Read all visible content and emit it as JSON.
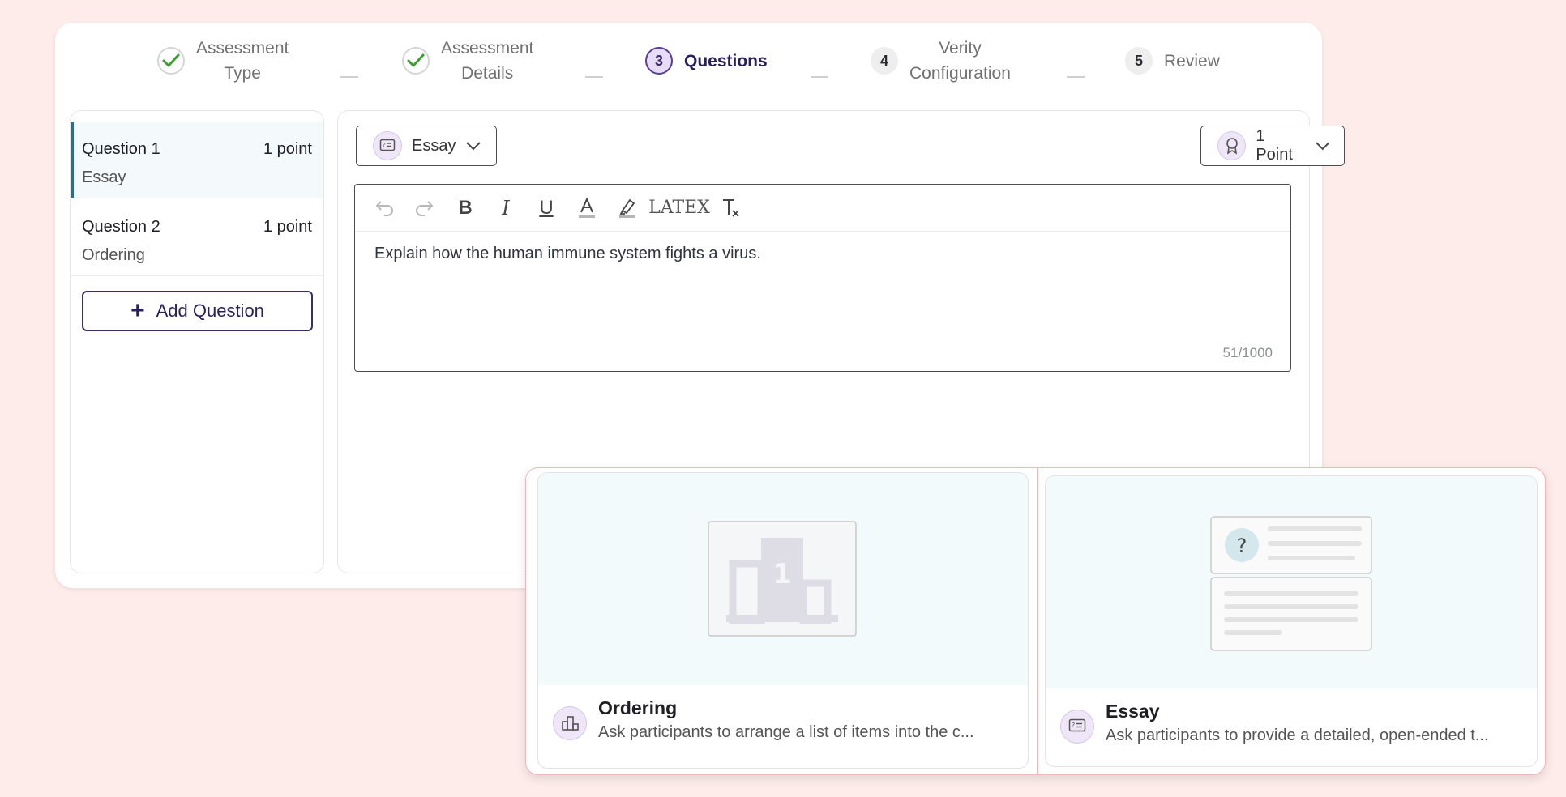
{
  "stepper": {
    "steps": [
      {
        "number": "",
        "label_line1": "Assessment",
        "label_line2": "Type",
        "status": "done"
      },
      {
        "number": "",
        "label_line1": "Assessment",
        "label_line2": "Details",
        "status": "done"
      },
      {
        "number": "3",
        "label_line1": "Questions",
        "label_line2": "",
        "status": "active"
      },
      {
        "number": "4",
        "label_line1": "Verity",
        "label_line2": "Configuration",
        "status": "todo"
      },
      {
        "number": "5",
        "label_line1": "Review",
        "label_line2": "",
        "status": "todo"
      }
    ]
  },
  "questions": [
    {
      "title": "Question 1",
      "points": "1 point",
      "type": "Essay"
    },
    {
      "title": "Question 2",
      "points": "1 point",
      "type": "Ordering"
    }
  ],
  "add_question_label": "Add Question",
  "editor": {
    "type_select": "Essay",
    "points_select": "1 Point",
    "toolbar": [
      "undo",
      "redo",
      "bold",
      "italic",
      "underline",
      "text-color",
      "highlight",
      "latex",
      "clear-format"
    ],
    "latex_label": "LATEX",
    "content": "Explain how the human immune system fights a virus.",
    "char_count": "51/1000"
  },
  "type_cards": [
    {
      "title": "Ordering",
      "description": "Ask participants to arrange a list of items into the c..."
    },
    {
      "title": "Essay",
      "description": "Ask participants to provide a detailed, open-ended t..."
    }
  ],
  "colors": {
    "accent": "#2a1f5e",
    "selected_bar": "#2f6f86",
    "check": "#3aa02f",
    "background": "#fdecea"
  }
}
